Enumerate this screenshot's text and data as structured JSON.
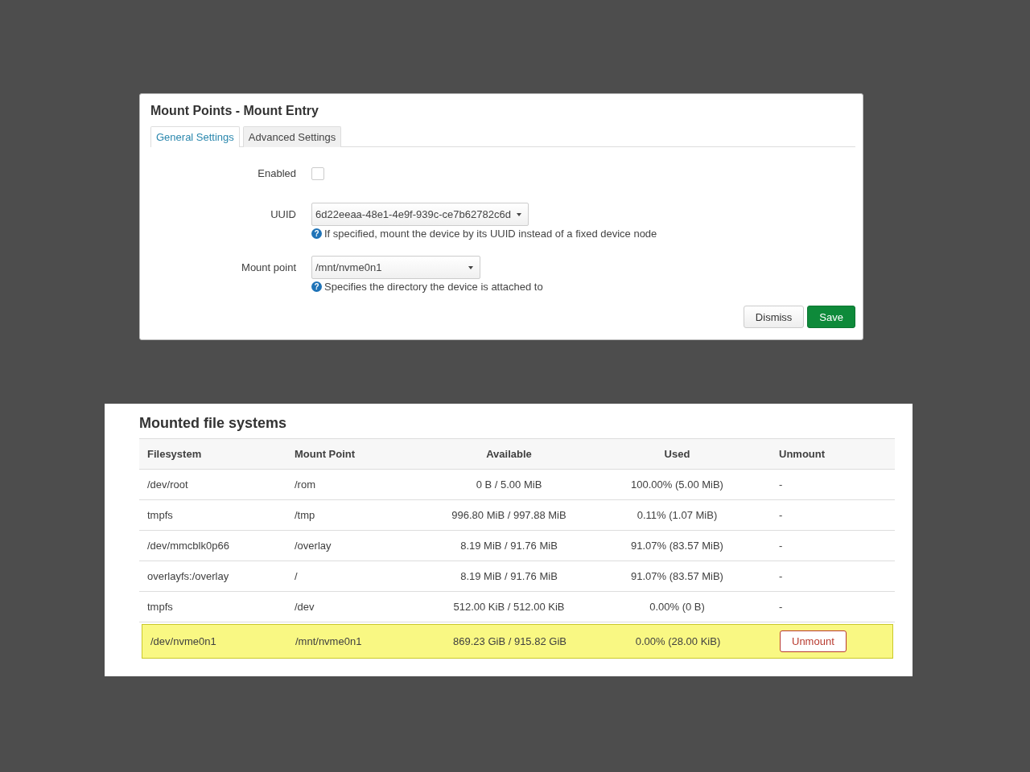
{
  "dialog": {
    "title": "Mount Points - Mount Entry",
    "tabs": [
      {
        "label": "General Settings",
        "selected": true
      },
      {
        "label": "Advanced Settings",
        "selected": false
      }
    ],
    "fields": [
      {
        "kind": "checkbox",
        "label": "Enabled",
        "checked": false
      },
      {
        "kind": "select",
        "label": "UUID",
        "value": "6d22eeaa-48e1-4e9f-939c-ce7b62782c6d",
        "help_icon": "?",
        "help": "If specified, mount the device by its UUID instead of a fixed device node"
      },
      {
        "kind": "select",
        "label": "Mount point",
        "value": "/mnt/nvme0n1",
        "help_icon": "?",
        "help": "Specifies the directory the device is attached to"
      }
    ],
    "buttons": [
      {
        "kind": "default",
        "label": "Dismiss"
      },
      {
        "kind": "primary",
        "label": "Save"
      }
    ]
  },
  "mounted": {
    "title": "Mounted file systems",
    "columns": [
      "Filesystem",
      "Mount Point",
      "Available",
      "Used",
      "Unmount"
    ],
    "rows": [
      {
        "filesystem": "/dev/root",
        "mount_point": "/rom",
        "available": "0 B / 5.00 MiB",
        "used": "100.00% (5.00 MiB)",
        "unmount": {
          "kind": "text",
          "text": "-"
        },
        "highlighted": false
      },
      {
        "filesystem": "tmpfs",
        "mount_point": "/tmp",
        "available": "996.80 MiB / 997.88 MiB",
        "used": "0.11% (1.07 MiB)",
        "unmount": {
          "kind": "text",
          "text": "-"
        },
        "highlighted": false
      },
      {
        "filesystem": "/dev/mmcblk0p66",
        "mount_point": "/overlay",
        "available": "8.19 MiB / 91.76 MiB",
        "used": "91.07% (83.57 MiB)",
        "unmount": {
          "kind": "text",
          "text": "-"
        },
        "highlighted": false
      },
      {
        "filesystem": "overlayfs:/overlay",
        "mount_point": "/",
        "available": "8.19 MiB / 91.76 MiB",
        "used": "91.07% (83.57 MiB)",
        "unmount": {
          "kind": "text",
          "text": "-"
        },
        "highlighted": false
      },
      {
        "filesystem": "tmpfs",
        "mount_point": "/dev",
        "available": "512.00 KiB / 512.00 KiB",
        "used": "0.00% (0 B)",
        "unmount": {
          "kind": "text",
          "text": "-"
        },
        "highlighted": false
      },
      {
        "filesystem": "/dev/nvme0n1",
        "mount_point": "/mnt/nvme0n1",
        "available": "869.23 GiB / 915.82 GiB",
        "used": "0.00% (28.00 KiB)",
        "unmount": {
          "kind": "button",
          "text": "Unmount"
        },
        "highlighted": true
      }
    ]
  }
}
